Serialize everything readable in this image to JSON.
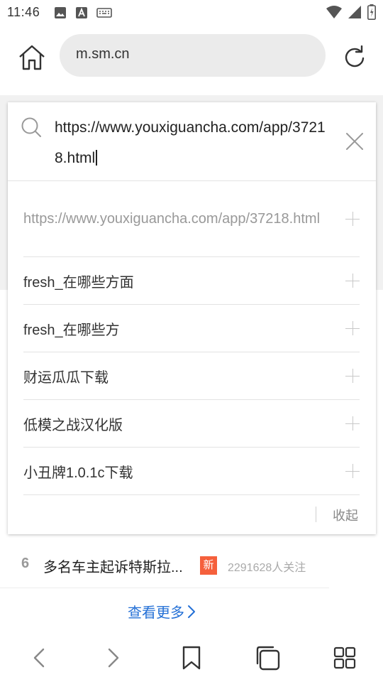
{
  "status_bar": {
    "time": "11:46",
    "left_icons": [
      "image-icon",
      "text-a-icon",
      "keyboard-icon"
    ],
    "right_icons": [
      "wifi-icon",
      "signal-icon",
      "battery-icon"
    ]
  },
  "browser": {
    "url": "m.sm.cn"
  },
  "search": {
    "query": "https://www.youxiguancha.com/app/37218.html"
  },
  "suggestions": [
    {
      "text": "https://www.youxiguancha.com/app/37218.html"
    },
    {
      "text": "fresh_在哪些方面"
    },
    {
      "text": "fresh_在哪些方"
    },
    {
      "text": "财运瓜瓜下载"
    },
    {
      "text": "低模之战汉化版"
    },
    {
      "text": "小丑牌1.0.1c下载"
    }
  ],
  "collapse_label": "收起",
  "news": {
    "rank": "6",
    "title": "多名车主起诉特斯拉...",
    "badge": "新",
    "count": "2291628人关注"
  },
  "see_more": "查看更多",
  "colors": {
    "accent_link": "#2470d6",
    "badge_new": "#f5603c",
    "url_pill_bg": "#ebebeb"
  }
}
